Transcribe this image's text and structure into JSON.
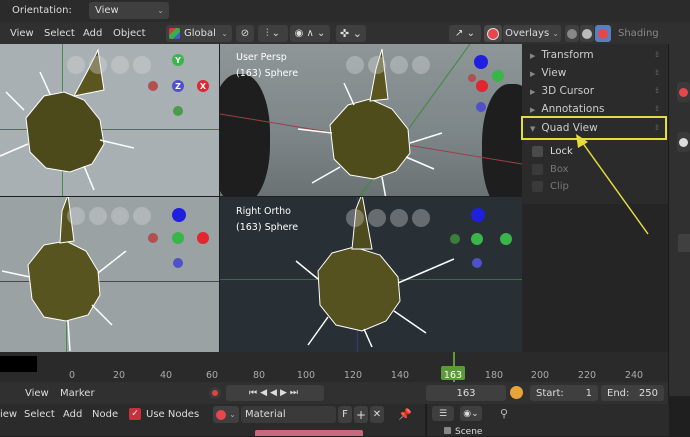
{
  "header": {
    "orientation_label": "Orientation:",
    "orientation_value": "View"
  },
  "menubar": {
    "view": "View",
    "select": "Select",
    "add": "Add",
    "object": "Object",
    "transform_orientation": "Global",
    "overlays": "Overlays",
    "shading": "Shading"
  },
  "viewports": {
    "top_right": {
      "title": "User Persp",
      "subtitle": "(163) Sphere"
    },
    "bottom_right": {
      "title": "Right Ortho",
      "subtitle": "(163) Sphere"
    }
  },
  "gizmo_labels": {
    "y": "Y",
    "z": "Z",
    "x": "X"
  },
  "sidebar": {
    "items": [
      {
        "label": "Transform"
      },
      {
        "label": "View"
      },
      {
        "label": "3D Cursor"
      },
      {
        "label": "Annotations"
      },
      {
        "label": "Quad View"
      }
    ],
    "quad_view": {
      "lock": "Lock",
      "box": "Box",
      "clip": "Clip"
    }
  },
  "timeline": {
    "ticks": [
      "0",
      "20",
      "40",
      "60",
      "80",
      "100",
      "120",
      "140",
      "163",
      "180",
      "200",
      "220",
      "240"
    ],
    "current_frame": "163",
    "start_label": "Start:",
    "start_value": "1",
    "end_label": "End:",
    "end_value": "250",
    "menu_view": "View",
    "menu_marker": "Marker"
  },
  "node_editor": {
    "view": "iew",
    "select": "Select",
    "add": "Add",
    "node": "Node",
    "use_nodes": "Use Nodes",
    "material": "Material",
    "fake_user": "F"
  },
  "outliner": {
    "scene": "Scene"
  },
  "colors": {
    "accent_highlight": "#e5dd3c",
    "x_axis": "#e0262e",
    "y_axis": "#39b54a",
    "z_axis": "#1f1fe0",
    "current_frame": "#5b9b3a"
  }
}
